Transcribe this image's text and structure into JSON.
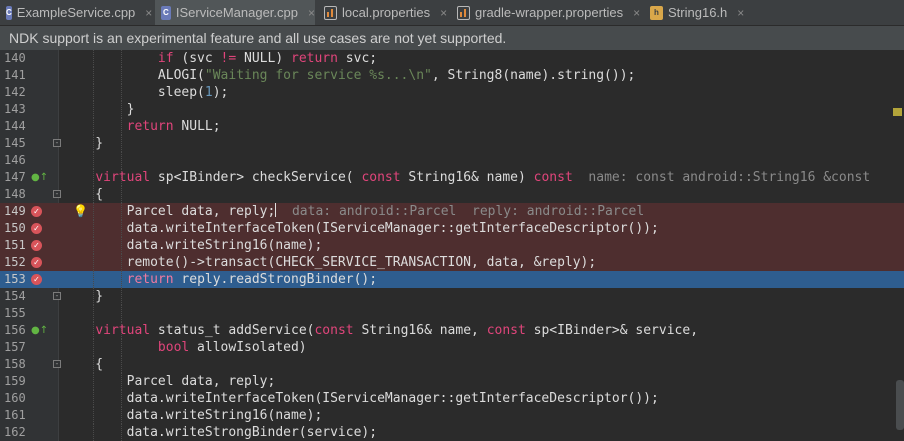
{
  "tabs": [
    {
      "name": "tab-exampleservice-cpp",
      "label": "ExampleService.cpp",
      "icon": "cpp-file-icon",
      "active": false
    },
    {
      "name": "tab-iservicemanager-cpp",
      "label": "IServiceManager.cpp",
      "icon": "cpp-file-icon",
      "active": true
    },
    {
      "name": "tab-local-properties",
      "label": "local.properties",
      "icon": "properties-file-icon",
      "active": false
    },
    {
      "name": "tab-gradle-wrapper-properties",
      "label": "gradle-wrapper.properties",
      "icon": "properties-file-icon",
      "active": false
    },
    {
      "name": "tab-string16-h",
      "label": "String16.h",
      "icon": "header-file-icon",
      "active": false
    }
  ],
  "tab_close_glyph": "×",
  "banner": {
    "text": "NDK support is an experimental feature and all use cases are not yet supported."
  },
  "colors": {
    "editor_bg": "#2b2b2b",
    "breakpoint_line": "#4e2e2f",
    "execution_line": "#2e5d8f",
    "keyword": "#cc7832",
    "string": "#6a8759",
    "number": "#6897bb"
  },
  "editor": {
    "lines": [
      {
        "n": "140",
        "segs": [
          [
            "            ",
            "plain"
          ],
          [
            "if",
            "kw2"
          ],
          [
            " (svc ",
            "plain"
          ],
          [
            "!=",
            "kw2"
          ],
          [
            " NULL) ",
            "plain"
          ],
          [
            "return",
            "kw2"
          ],
          [
            " svc;",
            "plain"
          ]
        ]
      },
      {
        "n": "141",
        "segs": [
          [
            "            ALOGI(",
            "plain"
          ],
          [
            "\"Waiting for service %s...\\n\"",
            "str"
          ],
          [
            ", String8(name).string());",
            "plain"
          ]
        ]
      },
      {
        "n": "142",
        "segs": [
          [
            "            sleep(",
            "plain"
          ],
          [
            "1",
            "num"
          ],
          [
            ");",
            "plain"
          ]
        ]
      },
      {
        "n": "143",
        "segs": [
          [
            "        }",
            "plain"
          ]
        ]
      },
      {
        "n": "144",
        "segs": [
          [
            "        ",
            "plain"
          ],
          [
            "return",
            "kw2"
          ],
          [
            " NULL;",
            "plain"
          ]
        ]
      },
      {
        "n": "145",
        "segs": [
          [
            "    }",
            "plain"
          ]
        ],
        "fold": true
      },
      {
        "n": "146",
        "segs": []
      },
      {
        "n": "147",
        "segs": [
          [
            "    ",
            "plain"
          ],
          [
            "virtual",
            "kw2"
          ],
          [
            " sp<IBinder> checkService( ",
            "plain"
          ],
          [
            "const",
            "kw2"
          ],
          [
            " String16& name) ",
            "plain"
          ],
          [
            "const",
            "kw2"
          ],
          [
            "  name: const android::String16 &const",
            "hint"
          ]
        ],
        "override": true
      },
      {
        "n": "148",
        "segs": [
          [
            "    {",
            "plain"
          ]
        ],
        "fold": true
      },
      {
        "n": "149",
        "segs": [
          [
            "        Parcel data, reply;",
            "plain"
          ],
          [
            "CARET",
            "caret"
          ],
          [
            "  data: android::Parcel  reply: android::Parcel",
            "hint"
          ]
        ],
        "bp": true,
        "bulb": true
      },
      {
        "n": "150",
        "segs": [
          [
            "        data.writeInterfaceToken(IServiceManager::getInterfaceDescriptor());",
            "plain"
          ]
        ],
        "bp": true
      },
      {
        "n": "151",
        "segs": [
          [
            "        data.writeString16(name);",
            "plain"
          ]
        ],
        "bp": true
      },
      {
        "n": "152",
        "segs": [
          [
            "        remote()->transact(CHECK_SERVICE_TRANSACTION, data, &reply);",
            "plain"
          ]
        ],
        "bp": true
      },
      {
        "n": "153",
        "segs": [
          [
            "        ",
            "plain"
          ],
          [
            "return",
            "kw2"
          ],
          [
            " reply.readStrongBinder();",
            "plain"
          ]
        ],
        "exec": true
      },
      {
        "n": "154",
        "segs": [
          [
            "    }",
            "plain"
          ]
        ],
        "fold": true
      },
      {
        "n": "155",
        "segs": []
      },
      {
        "n": "156",
        "segs": [
          [
            "    ",
            "plain"
          ],
          [
            "virtual",
            "kw2"
          ],
          [
            " status_t addService(",
            "plain"
          ],
          [
            "const",
            "kw2"
          ],
          [
            " String16& name, ",
            "plain"
          ],
          [
            "const",
            "kw2"
          ],
          [
            " sp<IBinder>& service,",
            "plain"
          ]
        ],
        "override": true
      },
      {
        "n": "157",
        "segs": [
          [
            "            ",
            "plain"
          ],
          [
            "bool",
            "kw2"
          ],
          [
            " allowIsolated)",
            "plain"
          ]
        ]
      },
      {
        "n": "158",
        "segs": [
          [
            "    {",
            "plain"
          ]
        ],
        "fold": true
      },
      {
        "n": "159",
        "segs": [
          [
            "        Parcel data, reply;",
            "plain"
          ]
        ]
      },
      {
        "n": "160",
        "segs": [
          [
            "        data.writeInterfaceToken(IServiceManager::getInterfaceDescriptor());",
            "plain"
          ]
        ]
      },
      {
        "n": "161",
        "segs": [
          [
            "        data.writeString16(name);",
            "plain"
          ]
        ]
      },
      {
        "n": "162",
        "segs": [
          [
            "        data.writeStrongBinder(service);",
            "plain"
          ]
        ]
      }
    ]
  }
}
